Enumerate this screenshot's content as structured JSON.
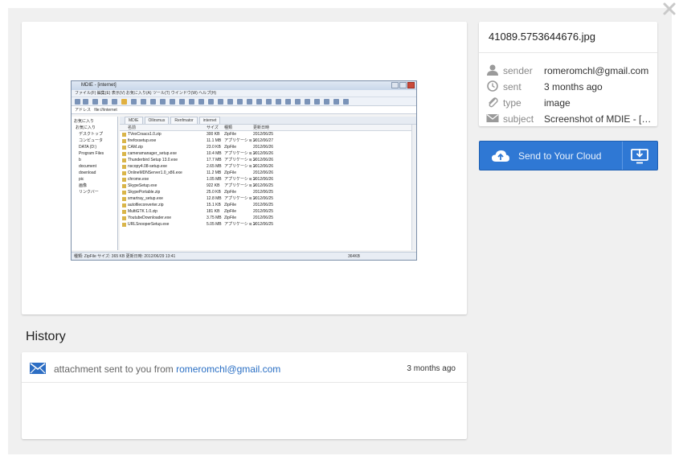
{
  "close_icon": "close-x-icon",
  "preview": {
    "window_title": "MDIE - [internet]",
    "menu": "ファイル(F)  編集(E)  表示(V)  お気に入り(A)  ツール(T)  ウインドウ(W)  ヘルプ(H)",
    "address_label": "アドレス",
    "address_value": "file:///internet",
    "tabs": [
      "MDIE",
      "Ollirsmus",
      "Renfmator",
      "internet"
    ],
    "tree": [
      "お気に入り",
      "お気に入り",
      "デスクトップ",
      "コンピュータ",
      "DATA (D:)",
      "Program Files",
      "b",
      "document",
      "download",
      "pic",
      "画像",
      "リンクバー"
    ],
    "columns": [
      "名前",
      "サイズ",
      "種類",
      "更新日時"
    ],
    "files": [
      {
        "name": "TVexCrsacs1.0.zip",
        "size": "300 KB",
        "type": "ZipFile",
        "date": "2012/06/25"
      },
      {
        "name": "firefoxsetup.exe",
        "size": "11.1 MB",
        "type": "アプリケーション",
        "date": "2012/06/27"
      },
      {
        "name": "CAM.zip",
        "size": "23.0 KB",
        "type": "ZipFile",
        "date": "2012/06/26"
      },
      {
        "name": "cameramanager_setup.exe",
        "size": "10.4 MB",
        "type": "アプリケーション",
        "date": "2012/06/26"
      },
      {
        "name": "Thunderbird Setup 13.0.exe",
        "size": "17.7 MB",
        "type": "アプリケーション",
        "date": "2012/06/26"
      },
      {
        "name": "nscopy4.08-setup.exe",
        "size": "2.65 MB",
        "type": "アプリケーション",
        "date": "2012/06/26"
      },
      {
        "name": "OnlineMDNServer1.0_x86.exe",
        "size": "11.2 MB",
        "type": "ZipFile",
        "date": "2012/06/26"
      },
      {
        "name": "chrome.exe",
        "size": "1.05 MB",
        "type": "アプリケーション",
        "date": "2012/06/26"
      },
      {
        "name": "SkypeSetup.exe",
        "size": "922 KB",
        "type": "アプリケーション",
        "date": "2012/06/25"
      },
      {
        "name": "SkypePortable.zip",
        "size": "25.0 KB",
        "type": "ZipFile",
        "date": "2012/06/25"
      },
      {
        "name": "smartray_setup.exe",
        "size": "12.8 MB",
        "type": "アプリケーション",
        "date": "2012/06/25"
      },
      {
        "name": "autofileconverter.zip",
        "size": "15.1 KB",
        "type": "ZipFile",
        "date": "2012/06/25"
      },
      {
        "name": "MultiGTK 1.0.zip",
        "size": "181 KB",
        "type": "ZipFile",
        "date": "2012/06/25"
      },
      {
        "name": "YoutubeDownloader.exe",
        "size": "3.75 MB",
        "type": "ZipFile",
        "date": "2012/06/25"
      },
      {
        "name": "URLSnooperSetup.exe",
        "size": "5.05 MB",
        "type": "アプリケーション",
        "date": "2012/06/25"
      }
    ],
    "status": "種類: ZipFile サイズ: 365 KB 更新日時: 2012/06/29 13:41",
    "status_size": "364KB"
  },
  "history": {
    "title": "History",
    "icon": "envelope-icon",
    "entry_prefix": "attachment sent to you from",
    "entry_email": "romeromchl@gmail.com",
    "entry_time": "3 months ago"
  },
  "meta": {
    "file_name": "41089.5753644676.jpg",
    "rows": [
      {
        "icon": "person-icon",
        "label": "sender",
        "value": "romeromchl@gmail.com"
      },
      {
        "icon": "clock-icon",
        "label": "sent",
        "value": "3 months ago"
      },
      {
        "icon": "paperclip-icon",
        "label": "type",
        "value": "image"
      },
      {
        "icon": "envelope-icon",
        "label": "subject",
        "value": "Screenshot of MDIE - [int..."
      }
    ]
  },
  "send_button": {
    "label": "Send to Your Cloud",
    "cloud_icon": "cloud-upload-icon",
    "download_icon": "download-to-screen-icon",
    "color": "#2f78d4"
  }
}
